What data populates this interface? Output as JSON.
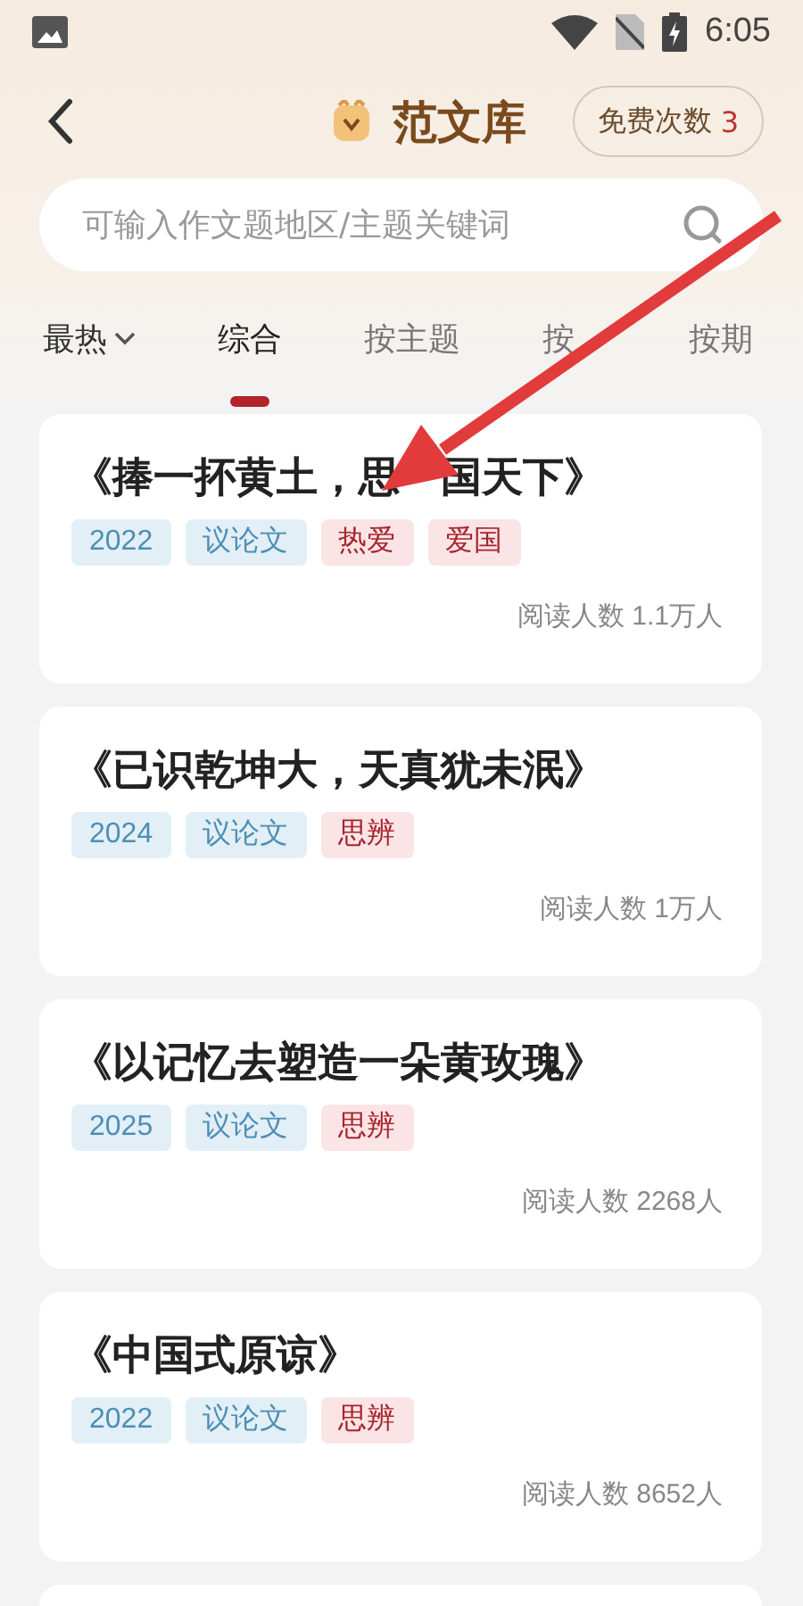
{
  "status_bar": {
    "time": "6:05"
  },
  "header": {
    "title": "范文库",
    "free_label": "免费次数",
    "free_count": "3"
  },
  "search": {
    "placeholder": "可输入作文题地区/主题关键词"
  },
  "tabs": [
    {
      "label": "最热",
      "kind": "sort",
      "selected": false
    },
    {
      "label": "综合",
      "kind": "tab",
      "selected": true
    },
    {
      "label": "按主题",
      "kind": "tab",
      "selected": false
    },
    {
      "label": "按",
      "kind": "tab",
      "selected": false
    },
    {
      "label": "按期",
      "kind": "tab",
      "selected": false
    }
  ],
  "articles": [
    {
      "title": "《捧一抔黄土，思　国天下》",
      "tags": [
        {
          "label": "2022",
          "kind": "info"
        },
        {
          "label": "议论文",
          "kind": "info"
        },
        {
          "label": "热爱",
          "kind": "topic"
        },
        {
          "label": "爱国",
          "kind": "topic"
        }
      ],
      "readers": "阅读人数 1.1万人"
    },
    {
      "title": "《已识乾坤大，天真犹未泯》",
      "tags": [
        {
          "label": "2024",
          "kind": "info"
        },
        {
          "label": "议论文",
          "kind": "info"
        },
        {
          "label": "思辨",
          "kind": "topic"
        }
      ],
      "readers": "阅读人数 1万人"
    },
    {
      "title": "《以记忆去塑造一朵黄玫瑰》",
      "tags": [
        {
          "label": "2025",
          "kind": "info"
        },
        {
          "label": "议论文",
          "kind": "info"
        },
        {
          "label": "思辨",
          "kind": "topic"
        }
      ],
      "readers": "阅读人数 2268人"
    },
    {
      "title": "《中国式原谅》",
      "tags": [
        {
          "label": "2022",
          "kind": "info"
        },
        {
          "label": "议论文",
          "kind": "info"
        },
        {
          "label": "思辨",
          "kind": "topic"
        }
      ],
      "readers": "阅读人数 8652人"
    }
  ]
}
